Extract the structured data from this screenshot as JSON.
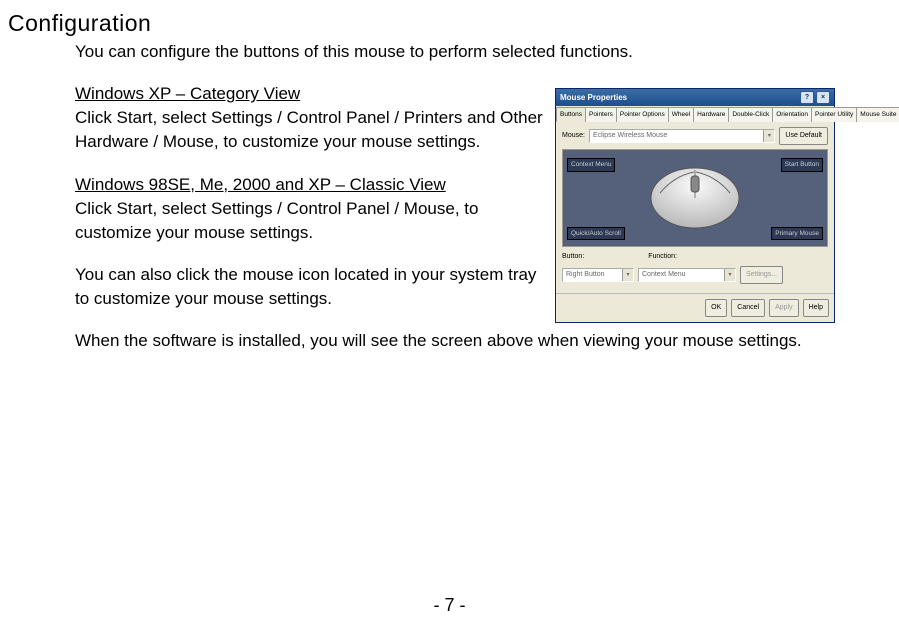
{
  "page_number_text": "- 7 -",
  "heading": "Configuration",
  "intro": "You can configure the buttons of this mouse to perform selected functions.",
  "xp_heading": "Windows XP – Category View",
  "xp_body": "Click Start, select Settings / Control Panel / Printers and Other Hardware / Mouse, to customize your mouse settings.",
  "classic_heading": "Windows 98SE, Me, 2000 and XP – Classic View",
  "classic_body": "Click Start, select Settings / Control Panel / Mouse, to customize your mouse settings.",
  "tray_text": "You can also click the mouse icon located in your system tray to customize your mouse settings.",
  "closing": "When the software is installed, you will see the screen above when viewing your mouse settings.",
  "dialog": {
    "title": "Mouse Properties",
    "tabs": [
      "Buttons",
      "Pointers",
      "Pointer Options",
      "Wheel",
      "Hardware",
      "Double-Click",
      "Orientation",
      "Pointer Utility",
      "Mouse Suite"
    ],
    "active_tab_index": 0,
    "mouse_label": "Mouse:",
    "mouse_value": "Eclipse Wireless Mouse",
    "use_default": "Use Default",
    "tags": {
      "context_menu": "Context Menu",
      "start_button": "Start Button",
      "quick_auto_scroll": "Quick/Auto Scroll",
      "primary_mouse": "Primary Mouse"
    },
    "button_label": "Button:",
    "button_value": "Right Button",
    "function_label": "Function:",
    "function_value": "Context Menu",
    "settings_btn": "Settings...",
    "footer": {
      "ok": "OK",
      "cancel": "Cancel",
      "apply": "Apply",
      "help": "Help"
    }
  }
}
